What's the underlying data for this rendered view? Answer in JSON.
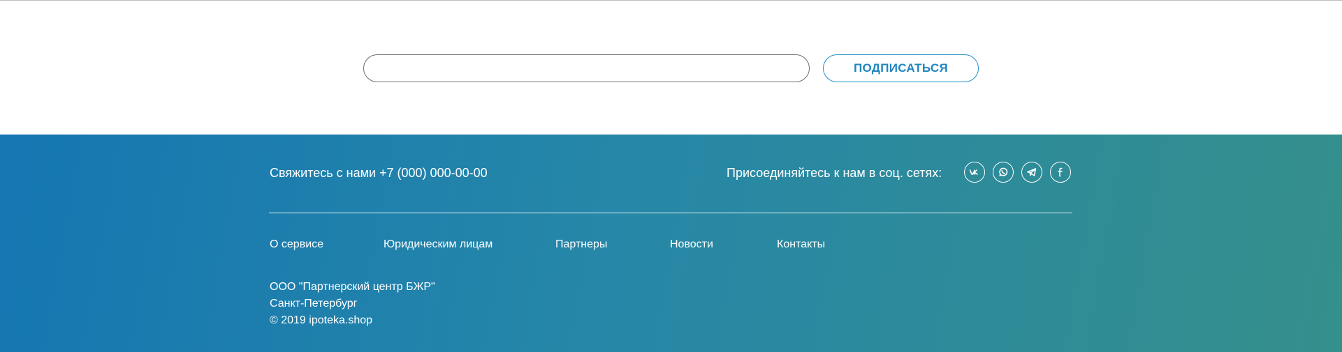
{
  "subscribe": {
    "email_placeholder": "",
    "button_label": "ПОДПИСАТЬСЯ"
  },
  "footer": {
    "contact_text": "Свяжитесь с нами +7 (000) 000-00-00",
    "social_label": "Присоединяйтесь к нам в соц. сетях:",
    "social_icons": [
      "vk-icon",
      "whatsapp-icon",
      "telegram-icon",
      "facebook-icon"
    ],
    "nav": [
      {
        "label": "О сервисе"
      },
      {
        "label": "Юридическим лицам"
      },
      {
        "label": "Партнеры"
      },
      {
        "label": "Новости"
      },
      {
        "label": "Контакты"
      }
    ],
    "company": {
      "name": "ООО \"Партнерский центр БЖР\"",
      "city": "Санкт-Петербург",
      "copyright": "© 2019 ipoteka.shop"
    }
  },
  "colors": {
    "accent": "#1f86c0",
    "footer_gradient_start": "#1576b2",
    "footer_gradient_end": "#358f8b"
  }
}
